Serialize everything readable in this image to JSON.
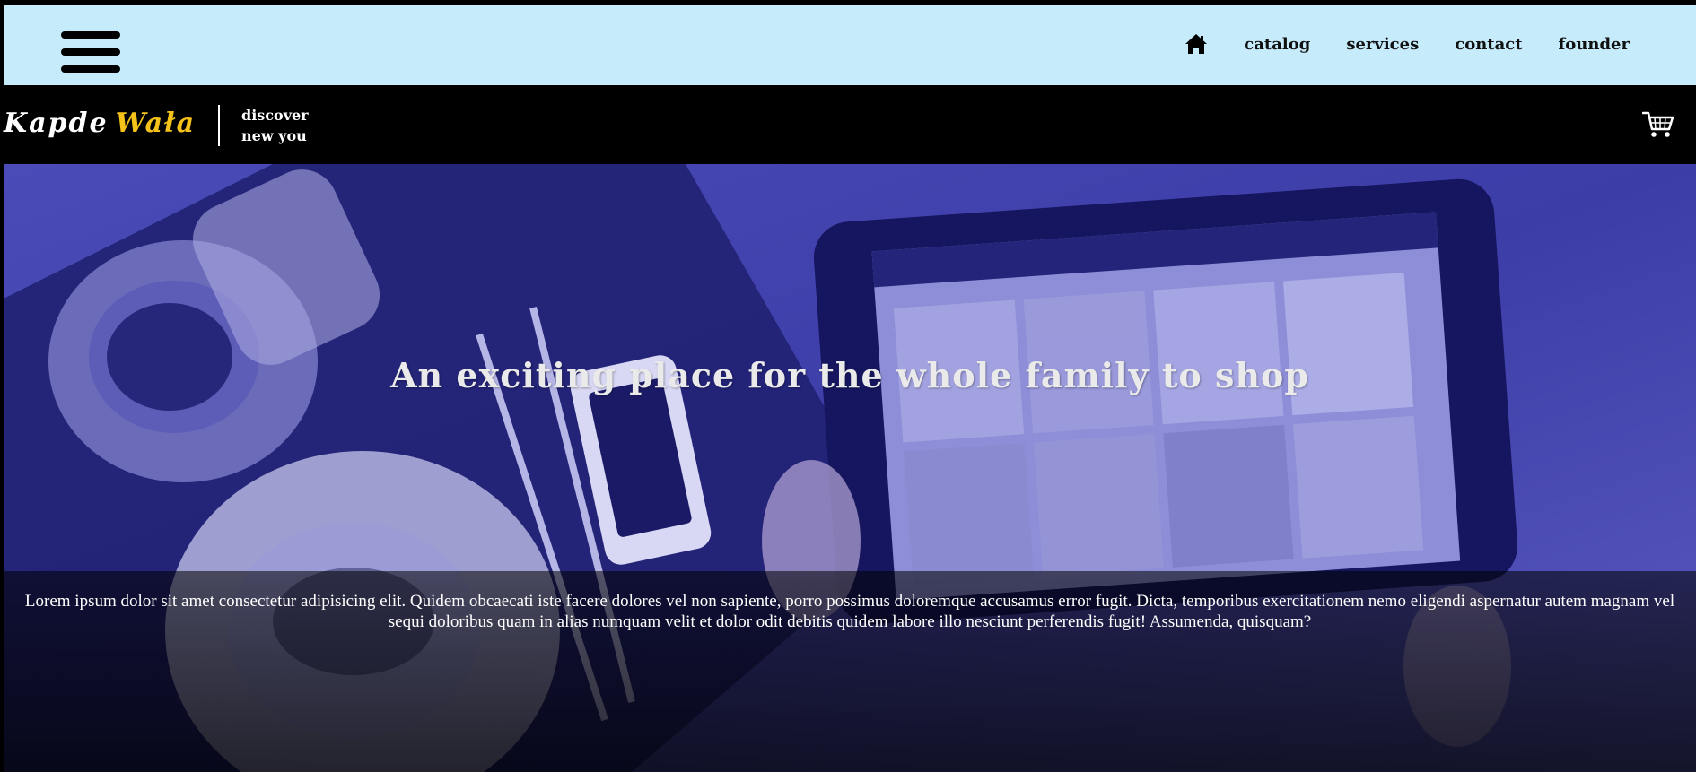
{
  "nav": {
    "menu_icon": "hamburger-icon",
    "home_icon": "home-icon",
    "links": [
      "catalog",
      "services",
      "contact",
      "founder"
    ]
  },
  "brand": {
    "word1": "Kapde",
    "word2": "Wała",
    "tagline_line1": "discover",
    "tagline_line2": "new you",
    "cart_icon": "cart-icon"
  },
  "hero": {
    "title": "An exciting place for the whole family to shop",
    "caption": "Lorem ipsum dolor sit amet consectetur adipisicing elit. Quidem obcaecati iste facere dolores vel non sapiente, porro possimus doloremque accusamus error fugit. Dicta, temporibus exercitationem nemo eligendi aspernatur autem magnam vel sequi doloribus quam in alias numquam velit et dolor odit debitis quidem labore illo nesciunt perferendis fugit! Assumenda, quisquam?"
  },
  "colors": {
    "nav_bg": "#c6ecfb",
    "brand_accent": "#f5c21a",
    "hero_tint": "#3a3aa0"
  }
}
